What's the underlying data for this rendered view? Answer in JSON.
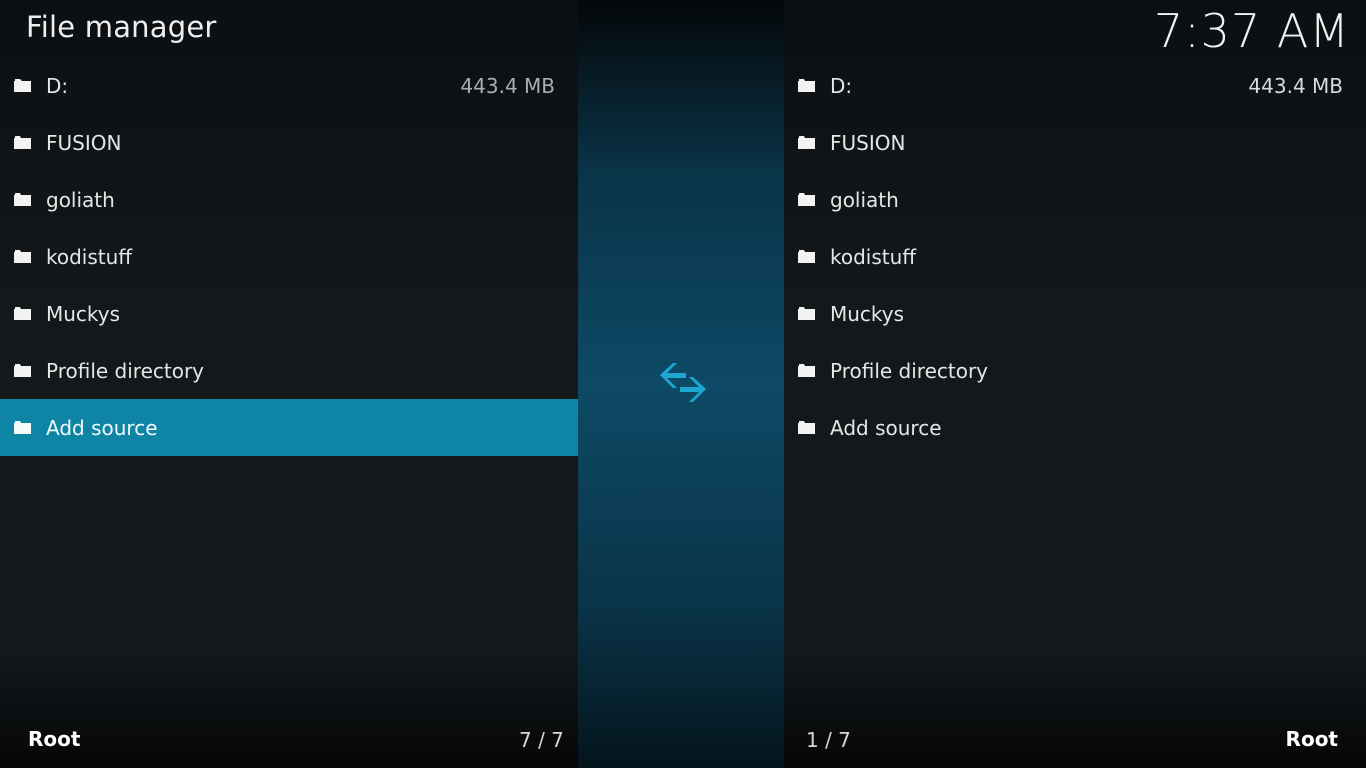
{
  "header": {
    "title": "File manager",
    "clock": "7:37 AM"
  },
  "colors": {
    "accent": "#0f85a6",
    "swap_icon": "#1da6d2"
  },
  "left_pane": {
    "items": [
      {
        "name": "D:",
        "size": "443.4 MB",
        "icon": "folder-icon"
      },
      {
        "name": "FUSION",
        "size": "",
        "icon": "folder-icon"
      },
      {
        "name": "goliath",
        "size": "",
        "icon": "folder-icon"
      },
      {
        "name": "kodistuff",
        "size": "",
        "icon": "folder-icon"
      },
      {
        "name": "Muckys",
        "size": "",
        "icon": "folder-icon"
      },
      {
        "name": "Profile directory",
        "size": "",
        "icon": "folder-icon"
      },
      {
        "name": "Add source",
        "size": "",
        "icon": "folder-icon",
        "selected": true
      }
    ],
    "path": "Root",
    "count": "7 / 7"
  },
  "center": {
    "icon": "swap-arrows-icon"
  },
  "right_pane": {
    "items": [
      {
        "name": "D:",
        "size": "443.4 MB",
        "icon": "folder-icon"
      },
      {
        "name": "FUSION",
        "size": "",
        "icon": "folder-icon"
      },
      {
        "name": "goliath",
        "size": "",
        "icon": "folder-icon"
      },
      {
        "name": "kodistuff",
        "size": "",
        "icon": "folder-icon"
      },
      {
        "name": "Muckys",
        "size": "",
        "icon": "folder-icon"
      },
      {
        "name": "Profile directory",
        "size": "",
        "icon": "folder-icon"
      },
      {
        "name": "Add source",
        "size": "",
        "icon": "folder-icon"
      }
    ],
    "path": "Root",
    "count": "1 / 7"
  }
}
